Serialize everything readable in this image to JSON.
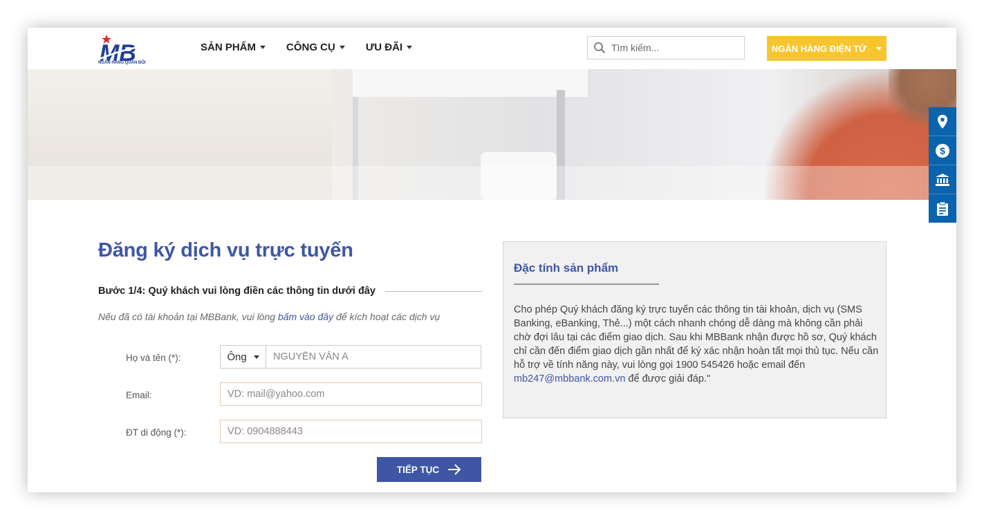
{
  "header": {
    "logo_text": "NGÂN HÀNG QUÂN ĐỘI",
    "nav": [
      {
        "label": "SẢN PHẨM"
      },
      {
        "label": "CÔNG CỤ"
      },
      {
        "label": "ƯU ĐÃI"
      }
    ],
    "search_placeholder": "Tìm kiếm...",
    "ebank_label": "NGÂN HÀNG ĐIỆN TỬ"
  },
  "side_bar": {
    "icons": [
      "location-icon",
      "dollar-icon",
      "bank-icon",
      "clipboard-icon"
    ]
  },
  "form": {
    "title": "Đăng ký dịch vụ trực tuyến",
    "step": "Bước 1/4: Quý khách vui lòng điền các thông tin dưới đây",
    "hint_prefix": "Nếu đã có tài khoản tại MBBank, vui lòng ",
    "hint_link": "bấm vào đây",
    "hint_suffix": " để kích hoạt các dịch vụ",
    "name_label": "Họ và tên (*):",
    "salutation": "Ông",
    "name_placeholder": "NGUYỄN VĂN A",
    "email_label": "Email:",
    "email_placeholder": "VD: mail@yahoo.com",
    "phone_label": "ĐT di động (*):",
    "phone_placeholder": "VD: 0904888443",
    "submit_label": "TIẾP TỤC"
  },
  "info": {
    "title": "Đặc tính sản phẩm",
    "text": "Cho phép Quý khách đăng ký trực tuyến các thông tin tài khoản, dịch vụ (SMS Banking, eBanking, Thẻ...) một cách nhanh chóng dễ dàng mà không cần phải chờ đợi lâu tại các điểm giao dịch. Sau khi MBBank nhận được hồ sơ, Quý khách chỉ cần đến điểm giao dịch gần nhất để ký xác nhận hoàn tất mọi thủ tục. Nếu cần hỗ trợ về tính năng này, vui lòng gọi 1900 545426 hoặc email đến ",
    "email_link": "mb247@mbbank.com.vn",
    "text_end": " để được giải đáp.\""
  },
  "colors": {
    "brand_blue": "#3e56a4",
    "accent_yellow": "#f9c52f",
    "side_blue": "#0a63ad",
    "logo_red": "#e2232a"
  }
}
